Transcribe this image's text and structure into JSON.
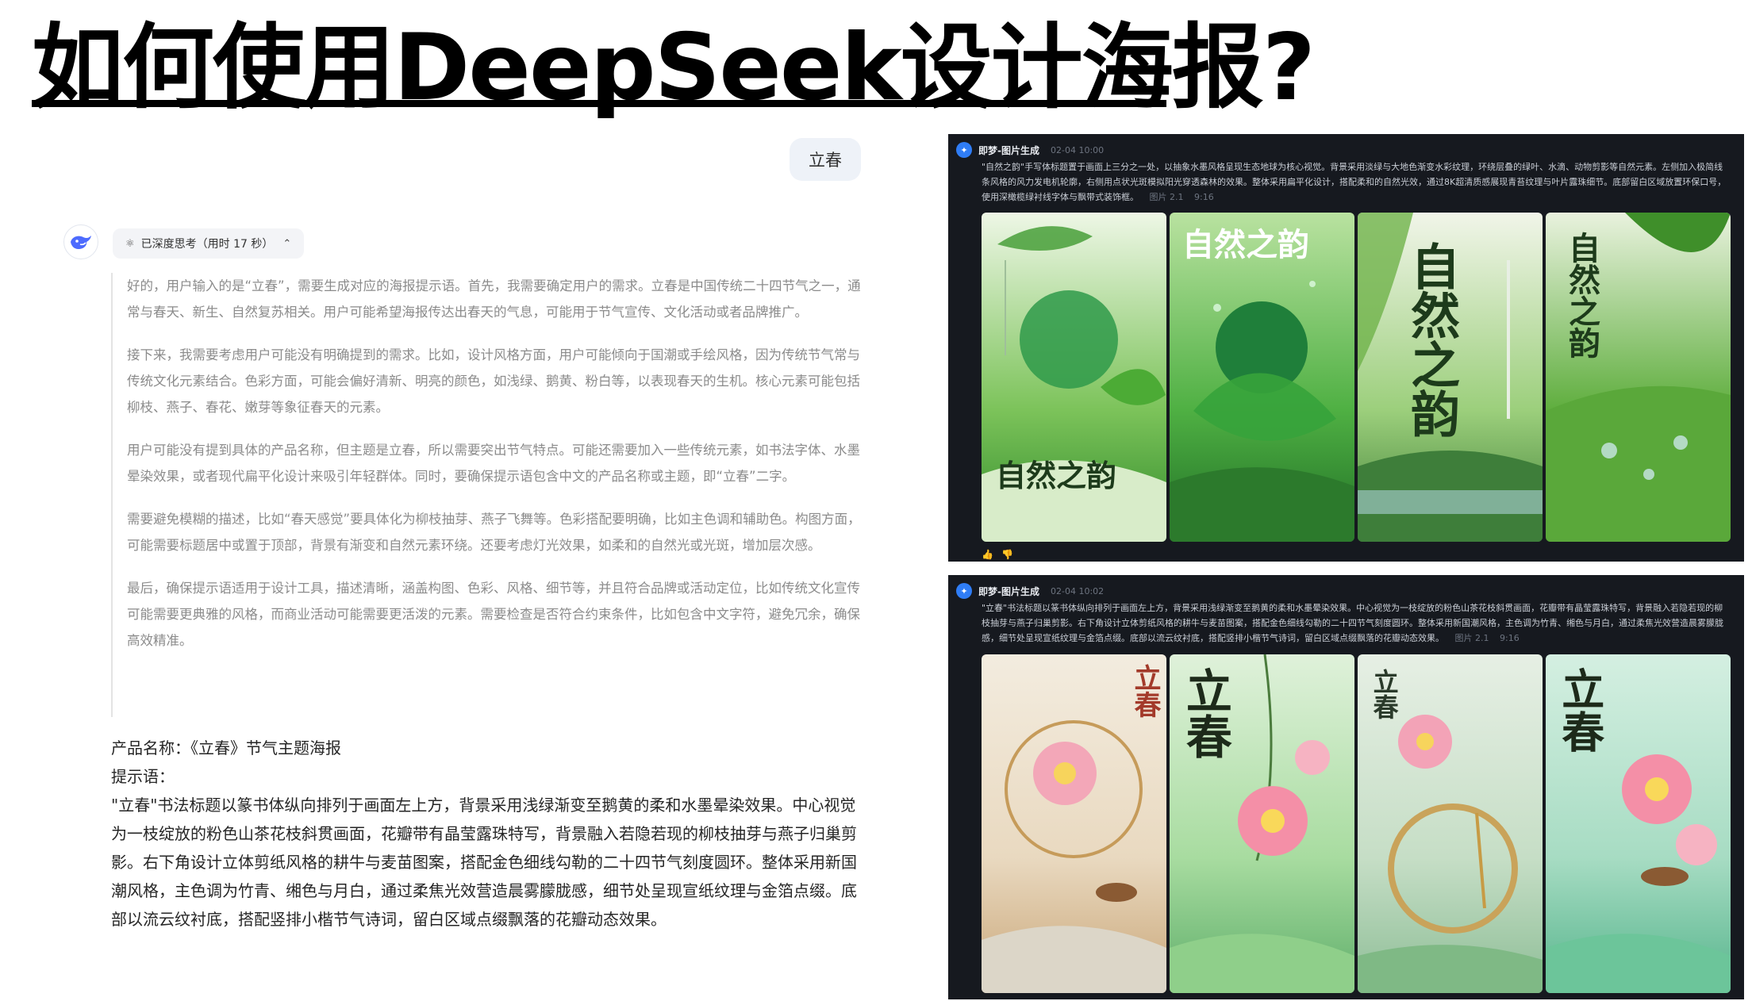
{
  "slide": {
    "title": "如何使用DeepSeek设计海报?"
  },
  "chat": {
    "user_message": "立春",
    "thinking": {
      "icon": "deep-think-icon",
      "label": "已深度思考（用时 17 秒）"
    },
    "reasoning": [
      "好的，用户输入的是“立春”，需要生成对应的海报提示语。首先，我需要确定用户的需求。立春是中国传统二十四节气之一，通常与春天、新生、自然复苏相关。用户可能希望海报传达出春天的气息，可能用于节气宣传、文化活动或者品牌推广。",
      "接下来，我需要考虑用户可能没有明确提到的需求。比如，设计风格方面，用户可能倾向于国潮或手绘风格，因为传统节气常与传统文化元素结合。色彩方面，可能会偏好清新、明亮的颜色，如浅绿、鹅黄、粉白等，以表现春天的生机。核心元素可能包括柳枝、燕子、春花、嫩芽等象征春天的元素。",
      "用户可能没有提到具体的产品名称，但主题是立春，所以需要突出节气特点。可能还需要加入一些传统元素，如书法字体、水墨晕染效果，或者现代扁平化设计来吸引年轻群体。同时，要确保提示语包含中文的产品名称或主题，即“立春”二字。",
      "需要避免模糊的描述，比如“春天感觉”要具体化为柳枝抽芽、燕子飞舞等。色彩搭配要明确，比如主色调和辅助色。构图方面，可能需要标题居中或置于顶部，背景有渐变和自然元素环绕。还要考虑灯光效果，如柔和的自然光或光斑，增加层次感。",
      "最后，确保提示语适用于设计工具，描述清晰，涵盖构图、色彩、风格、细节等，并且符合品牌或活动定位，比如传统文化宣传可能需要更典雅的风格，而商业活动可能需要更活泼的元素。需要检查是否符合约束条件，比如包含中文字符，避免冗余，确保高效精准。"
    ],
    "final_answer": {
      "product_line": "产品名称：《立春》节气主题海报",
      "prompt_label": "提示语：",
      "prompt_text": "\"立春\"书法标题以篆书体纵向排列于画面左上方，背景采用浅绿渐变至鹅黄的柔和水墨晕染效果。中心视觉为一枝绽放的粉色山茶花枝斜贯画面，花瓣带有晶莹露珠特写，背景融入若隐若现的柳枝抽芽与燕子归巢剪影。右下角设计立体剪纸风格的耕牛与麦苗图案，搭配金色细线勾勒的二十四节气刻度圆环。整体采用新国潮风格，主色调为竹青、缃色与月白，通过柔焦光效营造晨雾朦胧感，细节处呈现宣纸纹理与金箔点缀。底部以流云纹衬底，搭配竖排小楷节气诗词，留白区域点缀飘落的花瓣动态效果。"
    }
  },
  "generations": [
    {
      "app_name": "即梦-图片生成",
      "timestamp": "02-04  10:00",
      "prompt": "\"自然之韵\"手写体标题置于画面上三分之一处，以抽象水墨风格呈现生态地球为核心视觉。背景采用淡绿与大地色渐变水彩纹理，环绕层叠的绿叶、水滴、动物剪影等自然元素。左侧加入极简线条风格的风力发电机轮廓，右侧用点状光斑模拟阳光穿透森林的效果。整体采用扁平化设计，搭配柔和的自然光效，通过8K超清质感展现青苔纹理与叶片露珠细节。底部留白区域放置环保口号，使用深橄榄绿衬线字体与飘带式装饰框。",
      "model": "图片 2.1",
      "ratio": "9:16",
      "images": [
        {
          "title": "自然之韵",
          "colors": [
            "#eef7e6",
            "#7cc35a",
            "#2f8a2a"
          ]
        },
        {
          "title": "自然之韵",
          "colors": [
            "#b9e2a0",
            "#4fb043",
            "#1f6e25"
          ]
        },
        {
          "title": "自然之韵",
          "colors": [
            "#f1f5e9",
            "#9ccf7c",
            "#3c7d34"
          ]
        },
        {
          "title": "自然之韵",
          "colors": [
            "#e9f2de",
            "#5fae3e",
            "#1e5a1c"
          ]
        }
      ]
    },
    {
      "app_name": "即梦-图片生成",
      "timestamp": "02-04  10:02",
      "prompt": "\"立春\"书法标题以篆书体纵向排列于画面左上方，背景采用浅绿渐变至鹅黄的柔和水墨晕染效果。中心视觉为一枝绽放的粉色山茶花枝斜贯画面，花瓣带有晶莹露珠特写，背景融入若隐若现的柳枝抽芽与燕子归巢剪影。右下角设计立体剪纸风格的耕牛与麦苗图案，搭配金色细线勾勒的二十四节气刻度圆环。整体采用新国潮风格，主色调为竹青、缃色与月白，通过柔焦光效营造晨雾朦胧感，细节处呈现宣纸纹理与金箔点缀。底部以流云纹衬底，搭配竖排小楷节气诗词，留白区域点缀飘落的花瓣动态效果。",
      "model": "图片 2.1",
      "ratio": "9:16",
      "images": [
        {
          "title": "立春",
          "colors": [
            "#f3ecdf",
            "#e9d9c0",
            "#c9a678"
          ]
        },
        {
          "title": "立春",
          "colors": [
            "#dff1da",
            "#a8dca0",
            "#5fae6a"
          ]
        },
        {
          "title": "立春",
          "colors": [
            "#e6efe4",
            "#c6dec6",
            "#8dbd96"
          ]
        },
        {
          "title": "立春",
          "colors": [
            "#d4efe1",
            "#a7dcc3",
            "#56b48c"
          ]
        }
      ]
    }
  ]
}
